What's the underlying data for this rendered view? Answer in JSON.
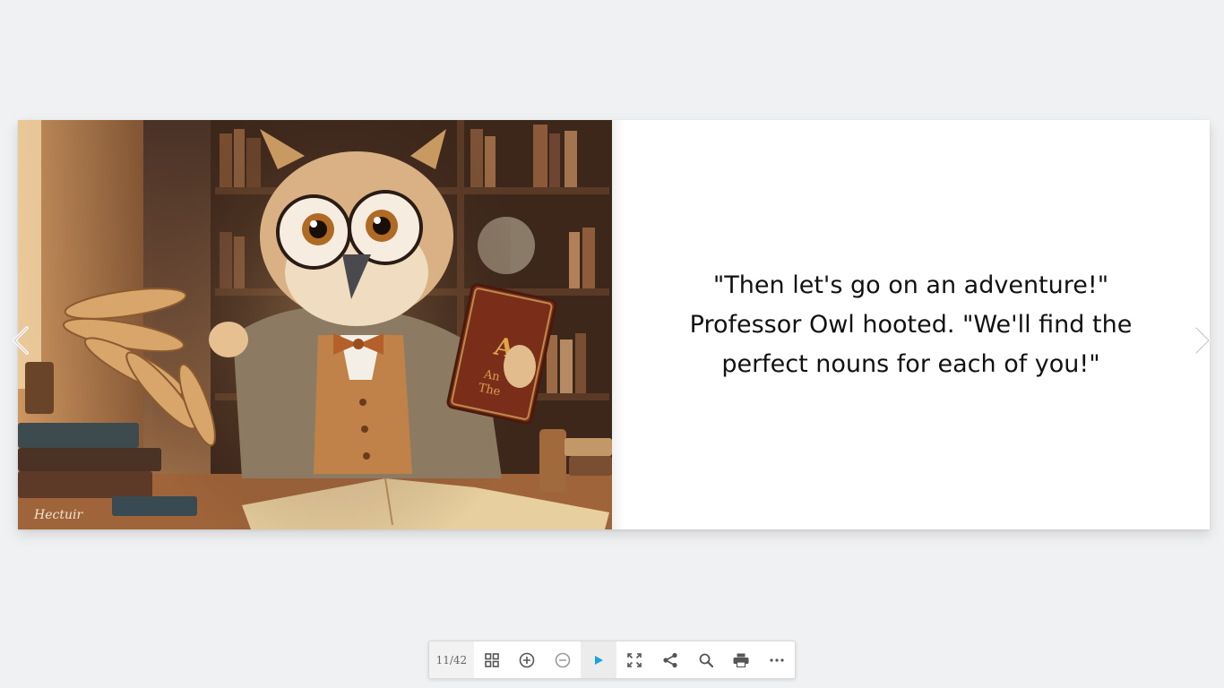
{
  "viewer": {
    "page_counter": "11/42"
  },
  "spread": {
    "right_page": {
      "text_lines": [
        "\"Then let's go on an adventure!\"",
        "Professor Owl hooted. \"We'll find the",
        "perfect nouns for each of you!\""
      ]
    },
    "left_page": {
      "image_subject": "Professor Owl wearing round glasses, tweed suit and bow tie, holding a book in a library",
      "book_cover_text": "A. An The",
      "signature": "Hectuir"
    }
  },
  "navigation": {
    "prev_icon": "chevron-left-icon",
    "next_icon": "chevron-right-icon"
  },
  "toolbar": {
    "buttons": [
      {
        "icon": "grid-icon"
      },
      {
        "icon": "zoom-in-icon"
      },
      {
        "icon": "zoom-out-icon"
      },
      {
        "icon": "play-icon"
      },
      {
        "icon": "fullscreen-icon"
      },
      {
        "icon": "share-icon"
      },
      {
        "icon": "search-icon"
      },
      {
        "icon": "print-icon"
      },
      {
        "icon": "more-icon"
      }
    ],
    "accent_color": "#1aa3d9"
  }
}
